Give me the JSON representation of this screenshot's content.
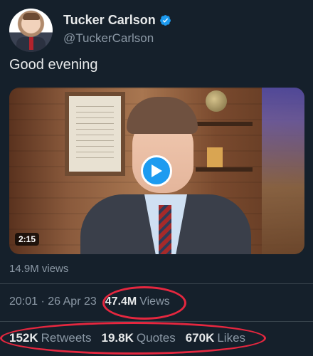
{
  "author": {
    "name": "Tucker Carlson",
    "handle": "@TuckerCarlson",
    "verified_icon": "verified-badge-icon"
  },
  "tweet": {
    "text": "Good evening"
  },
  "media": {
    "duration": "2:15",
    "play_icon": "play-icon",
    "views": "14.9M views"
  },
  "meta": {
    "timestamp": "20:01 · 26 Apr 23",
    "views_count": "47.4M",
    "views_label": "Views"
  },
  "stats": {
    "retweets_count": "152K",
    "retweets_label": "Retweets",
    "quotes_count": "19.8K",
    "quotes_label": "Quotes",
    "likes_count": "670K",
    "likes_label": "Likes"
  },
  "colors": {
    "background": "#15202b",
    "accent": "#1d9bf0",
    "highlight_circle": "#e5273f",
    "muted_text": "#8b98a5"
  }
}
